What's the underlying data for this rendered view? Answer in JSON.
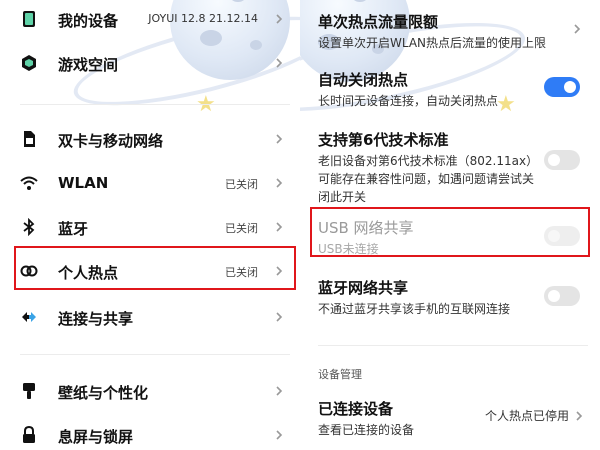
{
  "left_menu": {
    "items": [
      {
        "label": "我的设备",
        "value": "JOYUI 12.8 21.12.14",
        "icon": "phone-icon"
      },
      {
        "label": "游戏空间",
        "value": "",
        "icon": "cube-icon"
      },
      {
        "label": "双卡与移动网络",
        "value": "",
        "icon": "sim-card-icon"
      },
      {
        "label": "WLAN",
        "value": "已关闭",
        "icon": "wifi-icon"
      },
      {
        "label": "蓝牙",
        "value": "已关闭",
        "icon": "bluetooth-icon"
      },
      {
        "label": "个人热点",
        "value": "已关闭",
        "icon": "hotspot-icon"
      },
      {
        "label": "连接与共享",
        "value": "",
        "icon": "connection-share-icon"
      },
      {
        "label": "壁纸与个性化",
        "value": "",
        "icon": "brush-icon"
      },
      {
        "label": "息屏与锁屏",
        "value": "",
        "icon": "lock-icon"
      }
    ]
  },
  "right_settings": {
    "data_limit": {
      "title": "单次热点流量限额",
      "desc": "设置单次开启WLAN热点后流量的使用上限"
    },
    "auto_off": {
      "title": "自动关闭热点",
      "desc": "长时间无设备连接，自动关闭热点",
      "enabled": true
    },
    "wifi6": {
      "title": "支持第6代技术标准",
      "desc": "老旧设备对第6代技术标准（802.11ax）可能存在兼容性问题，如遇问题请尝试关闭此开关",
      "enabled": false
    },
    "usb_share": {
      "title": "USB 网络共享",
      "desc": "USB未连接",
      "enabled": false
    },
    "bt_share": {
      "title": "蓝牙网络共享",
      "desc": "不通过蓝牙共享该手机的互联网连接",
      "enabled": false
    },
    "section_device": "设备管理",
    "connected": {
      "title": "已连接设备",
      "desc": "查看已连接的设备",
      "value": "个人热点已停用"
    }
  },
  "colors": {
    "accent": "#2f7cf6",
    "highlight": "#e0161b",
    "toggle_off": "#e4e4e4"
  }
}
